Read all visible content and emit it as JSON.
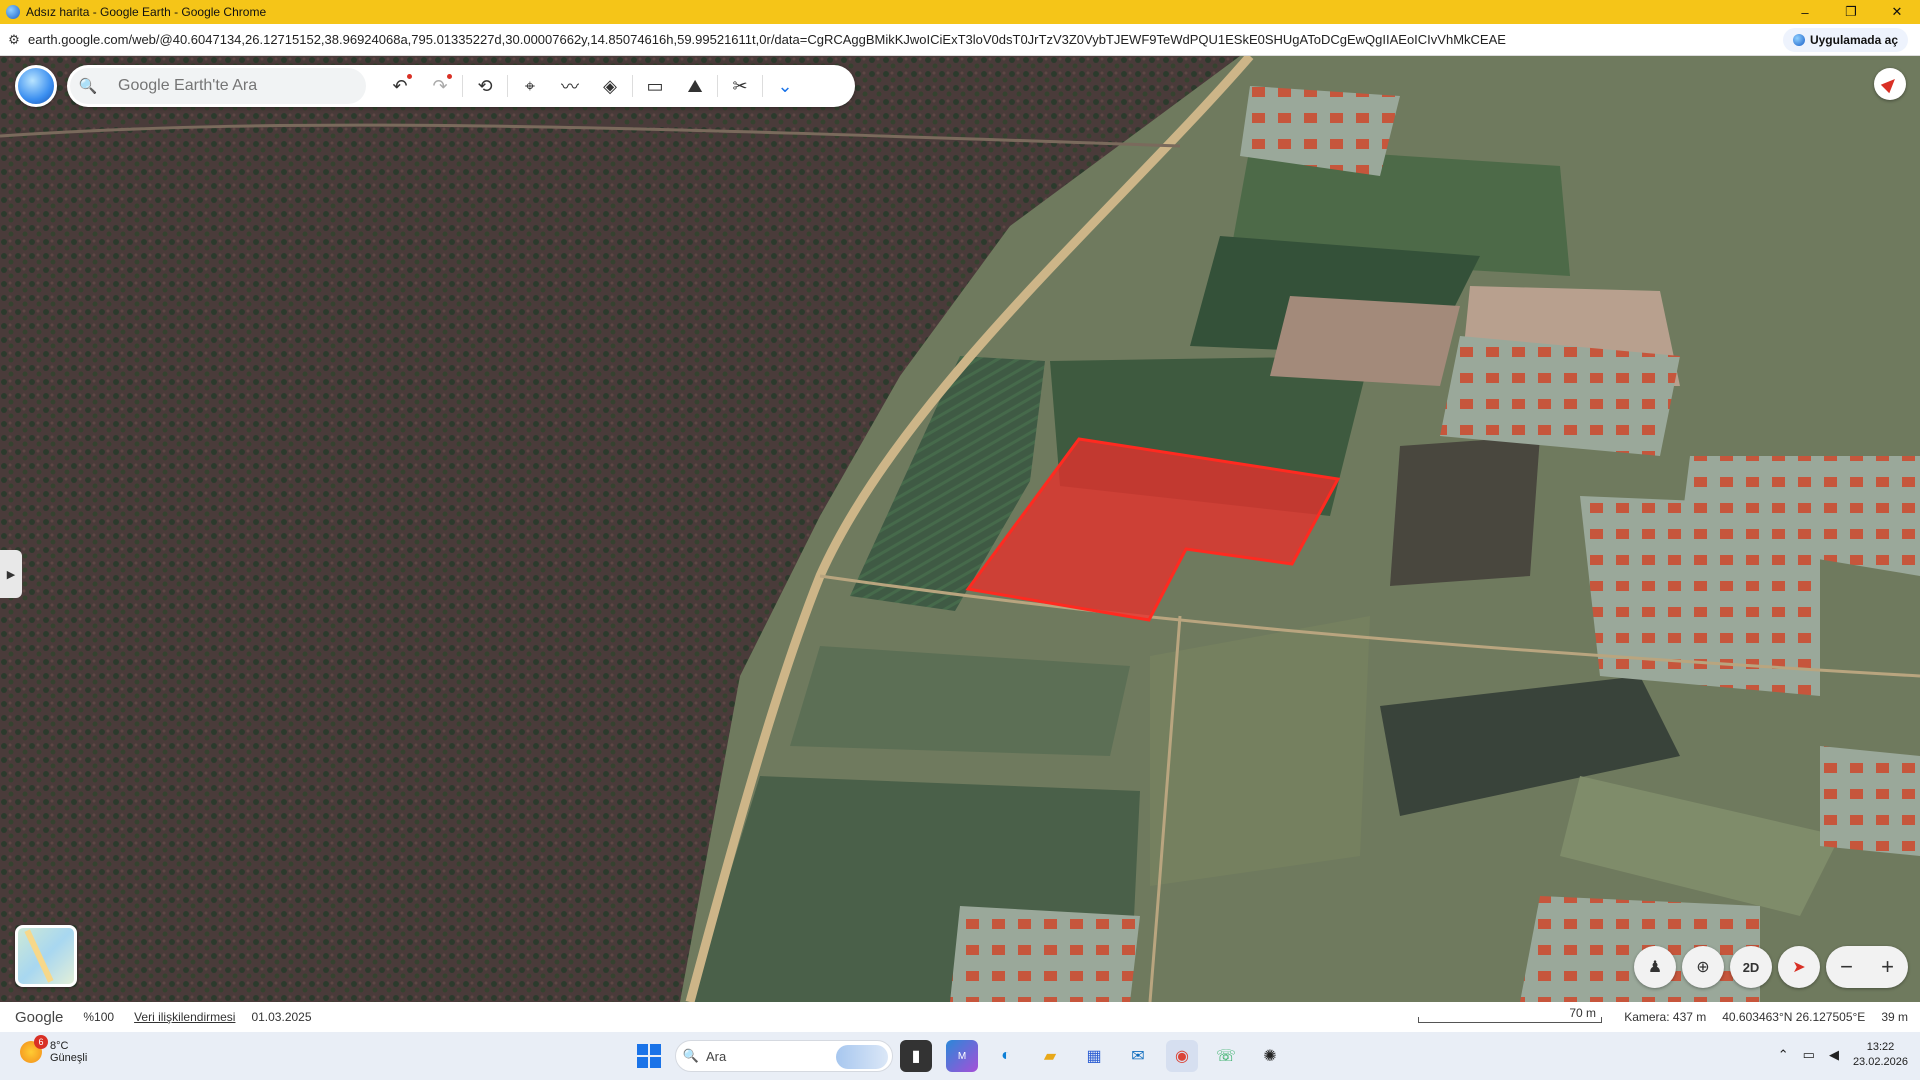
{
  "window": {
    "title": "Adsız harita - Google Earth - Google Chrome",
    "controls": {
      "minimize": "–",
      "restore": "❐",
      "close": "✕"
    }
  },
  "browser": {
    "url": "earth.google.com/web/@40.6047134,26.12715152,38.96924068a,795.01335227d,30.00007662y,14.85074616h,59.99521611t,0r/data=CgRCAggBMikKJwoICiExT3loV0dsT0JrTzV3Z0VybTJEWF9TeWdPQU1ESkE0SHUgAToDCgEwQgIIAEoICIvVhMkCEAE",
    "open_in_app": "Uygulamada aç",
    "tune_icon": "tune-icon"
  },
  "earth": {
    "search_placeholder": "Google Earth'te Ara",
    "toolbar_icons": [
      "undo-icon",
      "redo-icon",
      "history-icon",
      "placemark-icon",
      "path-icon",
      "layers-icon",
      "ruler-icon",
      "image-overlay-icon",
      "tools-icon",
      "chevron-down-icon"
    ],
    "highlight_color": "#e8302b",
    "view_2d_label": "2D",
    "zoom_out": "−",
    "zoom_in": "+"
  },
  "status": {
    "google_logo": "Google",
    "loaded_percent": "%100",
    "attribution": "Veri ilişkilendirmesi",
    "imagery_date": "01.03.2025",
    "scale_label": "70 m",
    "camera": "Kamera: 437 m",
    "coordinates": "40.603463°N 26.127505°E",
    "elevation": "39 m"
  },
  "taskbar": {
    "weather_temp": "8°C",
    "weather_desc": "Güneşli",
    "weather_badge": "6",
    "search_label": "Ara",
    "apps": [
      "file-manager-icon",
      "m365-icon",
      "edge-icon",
      "explorer-icon",
      "store-icon",
      "outlook-icon",
      "chrome-icon",
      "whatsapp-icon",
      "chatgpt-icon"
    ],
    "time": "13:22",
    "date": "23.02.2026"
  }
}
